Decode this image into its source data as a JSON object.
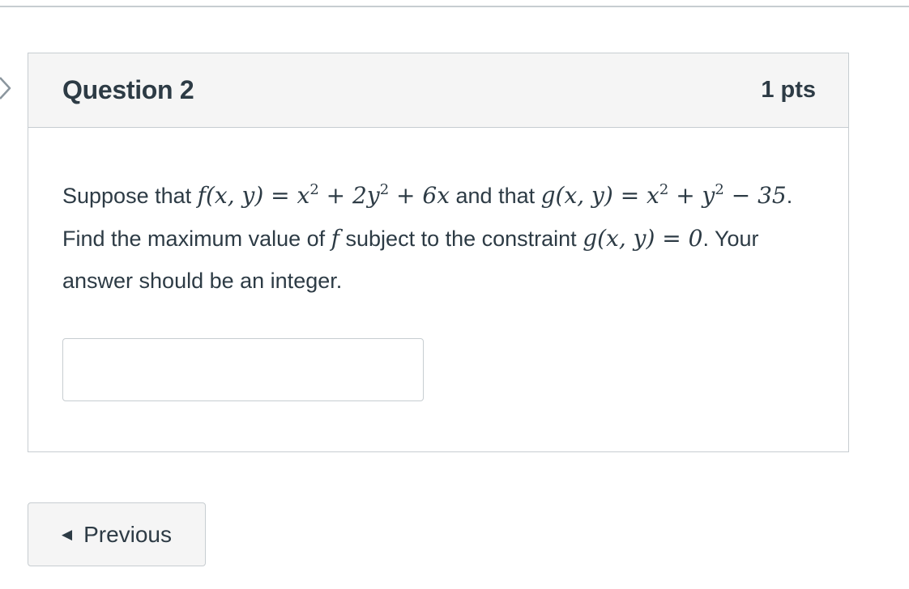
{
  "question": {
    "title": "Question 2",
    "points": "1 pts",
    "text": {
      "w1": "Suppose that ",
      "m_f_def": "f(x, y) = x",
      "m_f_exp1": "2",
      "m_f_mid": " + 2y",
      "m_f_exp2": "2",
      "m_f_end": " + 6x",
      "w2": " and that ",
      "m_g_def": "g(x, y) = x",
      "m_g_exp1": "2",
      "m_g_mid": " + y",
      "m_g_exp2": "2",
      "m_g_end": " − 35",
      "w3": ". Find the maximum value of ",
      "m_f": "f",
      "w4": " subject to the constraint ",
      "m_constraint": "g(x, y) = 0",
      "w5": ". Your answer should be an integer."
    },
    "answer": {
      "value": "",
      "placeholder": ""
    }
  },
  "nav": {
    "previous_icon": "caret-left-icon",
    "previous_label": "Previous"
  },
  "icons": {
    "flag": "flag-chevron-icon"
  },
  "colors": {
    "text": "#2d3b45",
    "border": "#c7cdd1",
    "header_bg": "#f5f5f5"
  }
}
